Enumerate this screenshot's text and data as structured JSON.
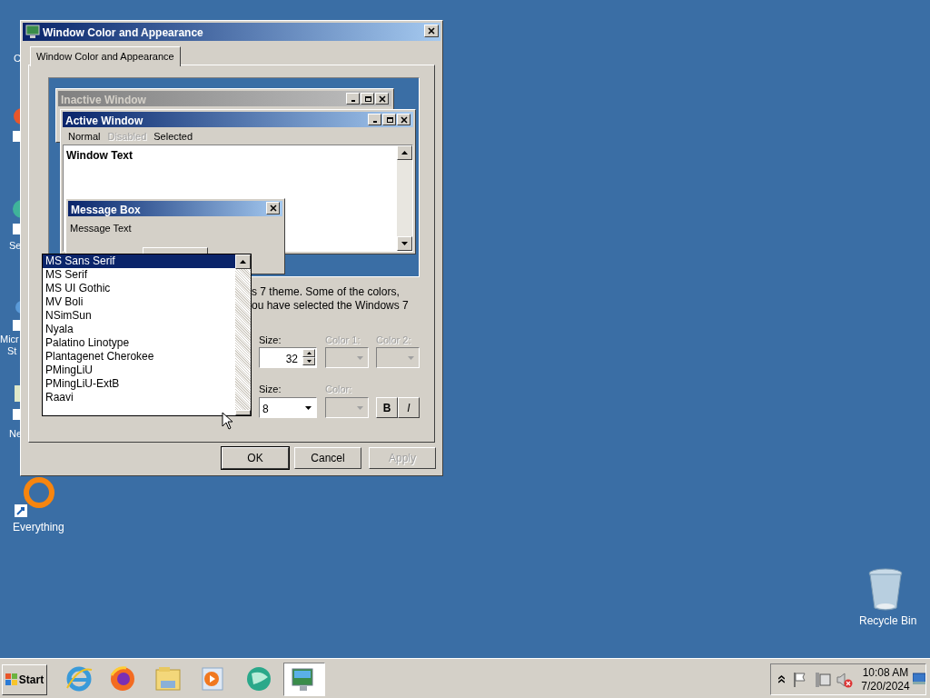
{
  "desktop_icons": [
    {
      "label": "C"
    },
    {
      "label": "Se"
    },
    {
      "label": "Micr"
    },
    {
      "label": "St"
    },
    {
      "label": "Ne"
    },
    {
      "label": "Everything"
    },
    {
      "label": "Recycle Bin"
    }
  ],
  "window": {
    "title": "Window Color and Appearance"
  },
  "tabs": [
    {
      "label": "Window Color and Appearance",
      "selected": true
    }
  ],
  "preview": {
    "inactive_window": {
      "title": "Inactive Window"
    },
    "active_window": {
      "title": "Active Window"
    },
    "menu_items": [
      {
        "label": "Normal",
        "kind": "normal"
      },
      {
        "label": "Disabled",
        "kind": "disabled"
      },
      {
        "label": "Selected",
        "kind": "selected"
      }
    ],
    "window_text": "Window Text",
    "message_box": {
      "title": "Message Box",
      "text": "Message Text"
    }
  },
  "font_list": [
    {
      "label": "MS Sans Serif",
      "selected": true
    },
    {
      "label": "MS Serif",
      "selected": false
    },
    {
      "label": "MS UI Gothic",
      "selected": false
    },
    {
      "label": "MV Boli",
      "selected": false
    },
    {
      "label": "NSimSun",
      "selected": false
    },
    {
      "label": "Nyala",
      "selected": false
    },
    {
      "label": "Palatino Linotype",
      "selected": false
    },
    {
      "label": "Plantagenet Cherokee",
      "selected": false
    },
    {
      "label": "PMingLiU",
      "selected": false
    },
    {
      "label": "PMingLiU-ExtB",
      "selected": false
    },
    {
      "label": "Raavi",
      "selected": false
    }
  ],
  "description": [
    "s 7 theme.  Some of the colors,",
    "ou have selected the Windows 7"
  ],
  "item_row": {
    "size_label": "Size:",
    "size_value": "32",
    "color1_label": "Color 1:",
    "color1_disabled": true,
    "color2_label": "Color 2:",
    "color2_disabled": true
  },
  "font_row": {
    "size_label": "Size:",
    "size_value": "8",
    "color_label": "Color:",
    "color_disabled": true,
    "bold": "B",
    "italic": "I"
  },
  "buttons": [
    {
      "label": "OK",
      "disabled": false
    },
    {
      "label": "Cancel",
      "disabled": false
    },
    {
      "label": "Apply",
      "disabled": true
    }
  ],
  "taskbar": {
    "start": "Start",
    "time": "10:08 AM",
    "date": "7/20/2024"
  }
}
